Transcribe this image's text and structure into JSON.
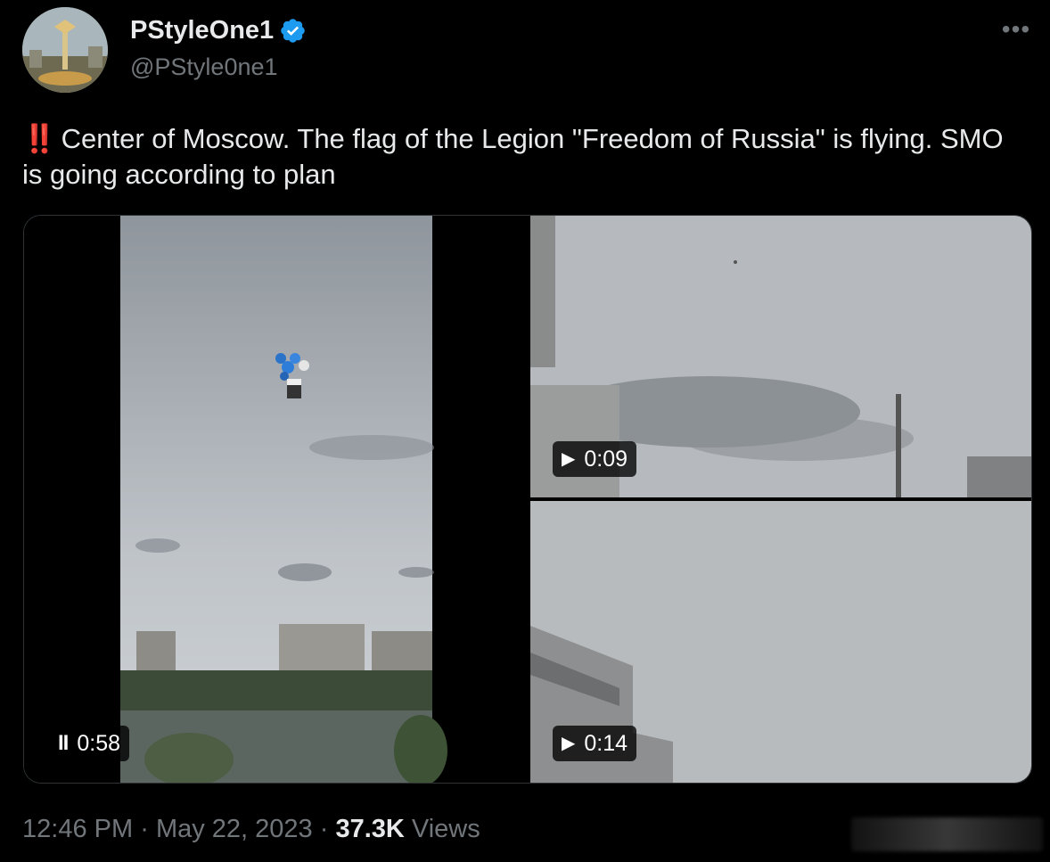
{
  "author": {
    "display_name": "PStyleOne1",
    "handle": "@PStyle0ne1",
    "verified_icon": "verified-badge-icon",
    "accent_color": "#1d9bf0"
  },
  "more_label": "•••",
  "tweet": {
    "emoji": "‼️",
    "text": "Center of Moscow. The flag of the Legion \"Freedom of Russia\" is flying. SMO is going according to plan"
  },
  "media": {
    "videos": [
      {
        "state_icon": "pause-icon",
        "state_glyph": "II",
        "duration": "0:58"
      },
      {
        "state_icon": "play-icon",
        "state_glyph": "▶",
        "duration": "0:09"
      },
      {
        "state_icon": "play-icon",
        "state_glyph": "▶",
        "duration": "0:14"
      }
    ]
  },
  "meta": {
    "time": "12:46 PM",
    "separator": "·",
    "date": "May 22, 2023",
    "views_count": "37.3K",
    "views_label": "Views"
  }
}
